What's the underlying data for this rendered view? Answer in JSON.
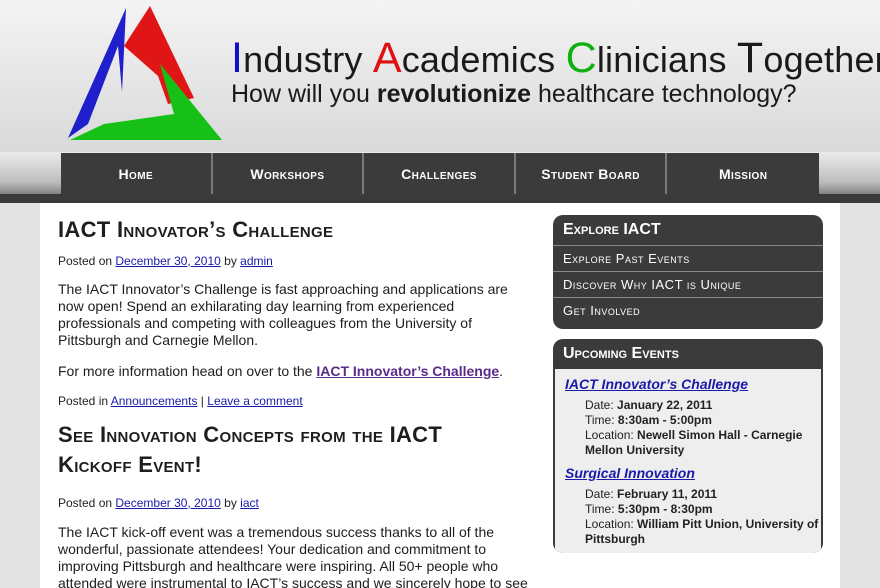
{
  "header": {
    "title_words": [
      {
        "cap": "I",
        "rest": "ndustry",
        "color": "#1010c0"
      },
      {
        "cap": "A",
        "rest": "cademics",
        "color": "#e01010"
      },
      {
        "cap": "C",
        "rest": "linicians",
        "color": "#10b010"
      },
      {
        "cap": "T",
        "rest": "ogether",
        "color": "#1a1a1a"
      }
    ],
    "tagline_pre": "How will you ",
    "tagline_bold": "revolutionize",
    "tagline_post": " healthcare technology?"
  },
  "nav": {
    "items": [
      "Home",
      "Workshops",
      "Challenges",
      "Student Board",
      "Mission"
    ]
  },
  "posts": [
    {
      "title": "IACT Innovator’s Challenge",
      "posted_on_label": "Posted on",
      "date": "December 30, 2010",
      "by_label": "by",
      "author": "admin",
      "para1": "The IACT Innovator’s Challenge is fast approaching and applications are now open! Spend an exhilarating day learning from experienced professionals and competing with colleagues from the University of Pittsburgh and Carnegie Mellon.",
      "para2_pre": "For more information head on over to the ",
      "para2_link": "IACT Innovator’s Challenge",
      "para2_post": ".",
      "posted_in_label": "Posted in",
      "category": "Announcements",
      "separator": "|",
      "comment_link": "Leave a comment"
    },
    {
      "title": "See Innovation Concepts from the IACT Kickoff Event!",
      "posted_on_label": "Posted on",
      "date": "December 30, 2010",
      "by_label": "by",
      "author": "iact",
      "para1": "The IACT kick-off event was a tremendous success thanks to all of the wonderful, passionate attendees! Your dedication and commitment to improving Pittsburgh and healthcare were inspiring. All 50+ people who attended were instrumental to IACT’s success and we sincerely hope to see everyone at future IACT events!"
    }
  ],
  "sidebar": {
    "explore": {
      "title": "Explore IACT",
      "links": [
        "Explore Past Events",
        "Discover Why IACT is Unique",
        "Get Involved"
      ]
    },
    "events": {
      "title": "Upcoming Events",
      "items": [
        {
          "title": "IACT Innovator’s Challenge",
          "date_label": "Date: ",
          "date": "January 22, 2011",
          "time_label": "Time: ",
          "time": "8:30am - 5:00pm",
          "location_label": "Location: ",
          "location": "Newell Simon Hall - Carnegie Mellon University"
        },
        {
          "title": "Surgical Innovation",
          "date_label": "Date: ",
          "date": "February 11, 2011",
          "time_label": "Time: ",
          "time": "5:30pm - 8:30pm",
          "location_label": "Location: ",
          "location": "William Pitt Union, University of Pittsburgh"
        }
      ]
    }
  },
  "colors": {
    "nav_bg": "#3b3b3b",
    "link": "#1a1aaa",
    "logo_blue": "#1f1fcc",
    "logo_red": "#e01616",
    "logo_green": "#16c016"
  }
}
